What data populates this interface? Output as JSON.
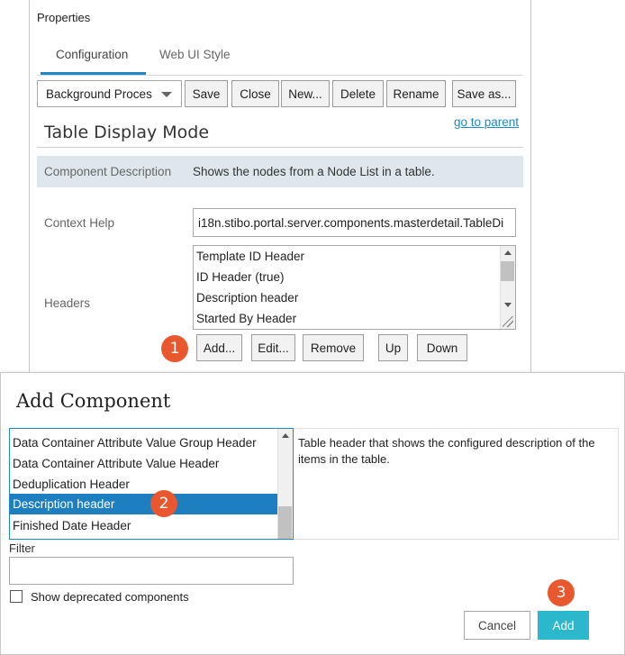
{
  "panel": {
    "title": "Properties",
    "tabs": [
      {
        "label": "Configuration",
        "active": true
      },
      {
        "label": "Web UI Style",
        "active": false
      }
    ],
    "toolbar": {
      "select_value": "Background Proces",
      "buttons": [
        "Save",
        "Close",
        "New...",
        "Delete",
        "Rename",
        "Save as..."
      ]
    },
    "goto_parent": "go to parent",
    "heading": "Table Display Mode",
    "component_description": {
      "label": "Component Description",
      "text": "Shows the nodes from a Node List in a table."
    },
    "context_help": {
      "label": "Context Help",
      "value": "i18n.stibo.portal.server.components.masterdetail.TableDi"
    },
    "headers": {
      "label": "Headers",
      "items": [
        "Template ID Header",
        "ID Header (true)",
        "Description header",
        "Started By Header"
      ],
      "buttons": [
        "Add...",
        "Edit...",
        "Remove",
        "Up",
        "Down"
      ]
    }
  },
  "callouts": [
    "1",
    "2",
    "3"
  ],
  "dialog": {
    "title": "Add Component",
    "items": [
      {
        "label": "Data Container Attribute Value Group Header",
        "selected": false
      },
      {
        "label": "Data Container Attribute Value Header",
        "selected": false
      },
      {
        "label": "Deduplication Header",
        "selected": false
      },
      {
        "label": "Description header",
        "selected": true
      },
      {
        "label": "Finished Date Header",
        "selected": false
      }
    ],
    "description": "Table header that shows the configured description of the items in the table.",
    "filter_label": "Filter",
    "filter_value": "",
    "show_deprecated_label": "Show deprecated components",
    "show_deprecated_checked": false,
    "cancel_label": "Cancel",
    "add_label": "Add"
  },
  "colors": {
    "accent": "#1e88c8",
    "selection": "#1e7fc0",
    "callout": "#e8572e",
    "add_button": "#2bb7cc",
    "description_bg": "#dfe7ec"
  },
  "icons": [
    "chevron-down-icon",
    "scroll-up-icon",
    "scroll-down-icon",
    "resize-grip-icon",
    "checkbox-icon"
  ]
}
